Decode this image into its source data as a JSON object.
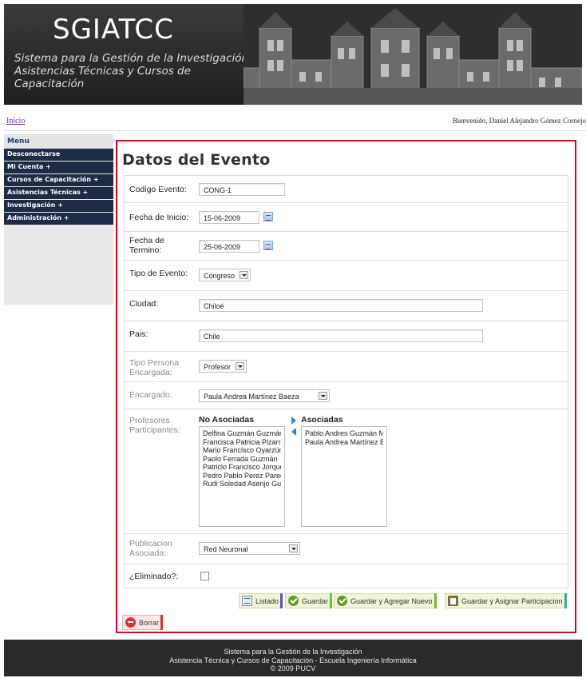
{
  "header": {
    "logo": "SGIATCC",
    "subtitle_line1": "Sistema para la Gestión de la Investigación,",
    "subtitle_line2": "Asistencias Técnicas y Cursos de Capacitación"
  },
  "topbar": {
    "home_link": "Inicio",
    "welcome": "Bienvenido, Daniel Alejandro Gómez Cornejo"
  },
  "sidebar": {
    "title": "Menu",
    "items": [
      {
        "label": "Desconectarse"
      },
      {
        "label": "Mi Cuenta +"
      },
      {
        "label": "Cursos de Capacitación +"
      },
      {
        "label": "Asistencias Técnicas +"
      },
      {
        "label": "Investigación +"
      },
      {
        "label": "Administración +"
      }
    ]
  },
  "form": {
    "title": "Datos del Evento",
    "codigo": {
      "label": "Codigo Evento:",
      "value": "CONG-1"
    },
    "fecha_inicio": {
      "label": "Fecha de Inicio:",
      "value": "15-06-2009"
    },
    "fecha_termino": {
      "label_line1": "Fecha de",
      "label_line2": "Termino:",
      "value": "25-06-2009"
    },
    "tipo_evento": {
      "label": "Tipo de Evento:",
      "value": "Congreso"
    },
    "ciudad": {
      "label": "Ciudad:",
      "value": "Chiloé"
    },
    "pais": {
      "label": "Pais:",
      "value": "Chile"
    },
    "tipo_persona": {
      "label_line1": "Tipo Persona",
      "label_line2": "Encargada:",
      "value": "Profesor"
    },
    "encargado": {
      "label": "Encargado:",
      "value": "Paula Andrea Martínez Baeza"
    },
    "profesores": {
      "label_line1": "Profesores",
      "label_line2": "Participantes:",
      "no_asociadas_label": "No Asociadas",
      "asociadas_label": "Asociadas",
      "no_asociadas": [
        "Delfina Guzmán Guzmán",
        "Francisca Patricia Pizarro",
        "Mario Francisco Oyarzún",
        "Paolo Ferrada Guzmán",
        "Patricio Francisco Jorque",
        "Pedro Pablo Perez Parede",
        "Rudi Soledad Asenjo Gua"
      ],
      "asociadas": [
        "Pablo Andres Guzmán Ma",
        "Paula Andrea Martínez Ba"
      ]
    },
    "publicacion": {
      "label_line1": "Publicacion",
      "label_line2": "Asociada:",
      "value": "Red Neuronal"
    },
    "eliminado": {
      "label": "¿Eliminado?:",
      "checked": false
    }
  },
  "buttons": {
    "listado": "Listado",
    "guardar": "Guardar",
    "guardar_agregar": "Guardar y Agregar Nuevo",
    "guardar_asignar": "Guardar y Asignar Participacion",
    "borrar": "Borrar"
  },
  "footer": {
    "line1": "Sistema para la Gestión de la Investigación",
    "line2": "Asistencia Técnica y Cursos de Capacitación - Escuela Ingeniería Informática",
    "line3": "© 2009 PUCV"
  },
  "colors": {
    "highlight_border": "#e0001b",
    "menu_bg": "#1e2b44",
    "link": "#663399"
  }
}
